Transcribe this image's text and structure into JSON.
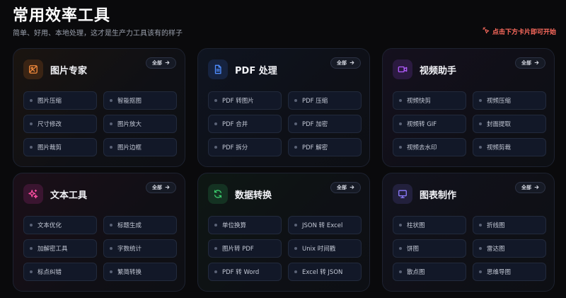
{
  "header": {
    "title": "常用效率工具",
    "subtitle": "简单、好用、本地处理，这才是生产力工具该有的样子",
    "hint": "点击下方卡片即可开始",
    "hint_icon": "pointer-click-icon"
  },
  "all_label": "全部",
  "colors": {
    "hint": "#ff6b5e",
    "image_tools": "#f28a3c",
    "pdf_tools": "#4f8dff",
    "video_tools": "#b35cff",
    "text_tools": "#ff4fa3",
    "data_tools": "#3ccf6e",
    "chart_tools": "#8f7dff"
  },
  "cards": [
    {
      "title": "图片专家",
      "icon": "image-edit-icon",
      "items": [
        "图片压缩",
        "智能抠图",
        "尺寸修改",
        "图片放大",
        "图片裁剪",
        "图片边框"
      ]
    },
    {
      "title": "PDF 处理",
      "icon": "document-icon",
      "items": [
        "PDF 转图片",
        "PDF 压缩",
        "PDF 合并",
        "PDF 加密",
        "PDF 拆分",
        "PDF 解密"
      ]
    },
    {
      "title": "视频助手",
      "icon": "video-camera-icon",
      "items": [
        "视频快剪",
        "视频压缩",
        "视频转 GIF",
        "封面提取",
        "视频去水印",
        "视频剪裁"
      ]
    },
    {
      "title": "文本工具",
      "icon": "sparkles-icon",
      "items": [
        "文本优化",
        "标题生成",
        "加解密工具",
        "字数统计",
        "标点纠错",
        "繁简转换"
      ]
    },
    {
      "title": "数据转换",
      "icon": "refresh-icon",
      "items": [
        "单位换算",
        "JSON 转 Excel",
        "图片转 PDF",
        "Unix 时间戳",
        "PDF 转 Word",
        "Excel 转 JSON"
      ]
    },
    {
      "title": "图表制作",
      "icon": "presentation-chart-icon",
      "items": [
        "柱状图",
        "折线图",
        "饼图",
        "雷达图",
        "散点图",
        "思维导图"
      ]
    }
  ]
}
